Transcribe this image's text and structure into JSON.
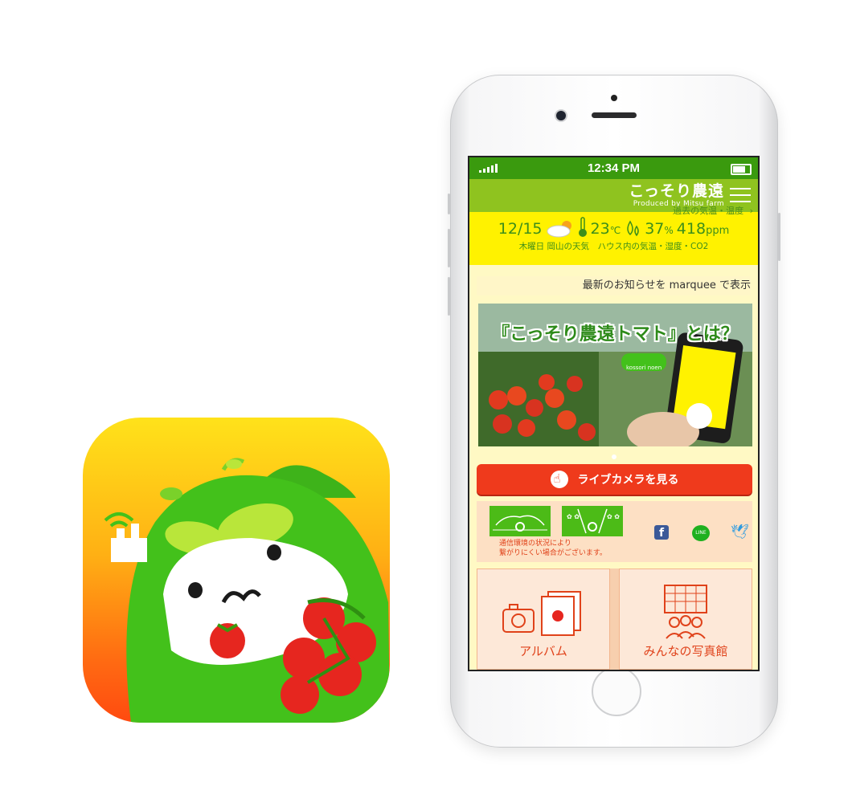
{
  "colors": {
    "status_bar": "#3a9a0e",
    "app_bar": "#8fc31f",
    "weather_band": "#fff200",
    "accent_red": "#ef3a1c",
    "text_green": "#3d8f1a"
  },
  "status_bar": {
    "time": "12:34 PM",
    "signal_icon": "signal-bars-icon",
    "battery_icon": "battery-icon"
  },
  "app_bar": {
    "title": "こっそり農遠",
    "subtitle": "Produced by Mitsu farm",
    "menu_icon": "hamburger-icon"
  },
  "weather": {
    "date": "12/15",
    "temperature": "23",
    "temperature_unit": "℃",
    "humidity": "37",
    "humidity_unit": "%",
    "co2": "418",
    "co2_unit": "ppm",
    "caption": "木曜日 岡山の天気　ハウス内の気温・湿度・CO2",
    "history_link": "過去の気温・温度"
  },
  "news": {
    "marquee_text": "最新のお知らせを marquee で表示"
  },
  "banner": {
    "title": "『こっそり農遠トマト』とは？",
    "badge_text": "kossori noen"
  },
  "live_camera": {
    "button_label": "ライブカメラを見る"
  },
  "cameras": {
    "note_line1": "通信環境の状況により",
    "note_line2": "繋がりにくい場合がございます。"
  },
  "social": {
    "facebook": "f",
    "line": "LINE",
    "twitter": "twitter-icon"
  },
  "tiles": [
    {
      "label": "アルバム",
      "icon": "album-camera-icon"
    },
    {
      "label": "みんなの写真館",
      "icon": "photo-gallery-people-icon"
    }
  ]
}
